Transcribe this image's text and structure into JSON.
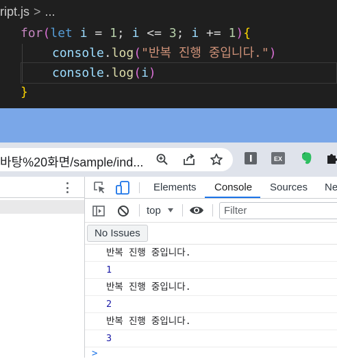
{
  "editor": {
    "breadcrumb": {
      "file": "ript.js",
      "separator": ">",
      "ellipsis": "..."
    },
    "code": {
      "line1": {
        "kw_for": "for",
        "open_paren": "(",
        "kw_let": "let",
        "var_i1": "i",
        "eq": " = ",
        "num_start": "1",
        "semi1": "; ",
        "var_i2": "i",
        "lte": " <= ",
        "num_end": "3",
        "semi2": "; ",
        "var_i3": "i",
        "inc": " += ",
        "num_step": "1",
        "close_paren": ")",
        "open_brace": "{"
      },
      "line2": {
        "obj": "console",
        "dot": ".",
        "method": "log",
        "open_paren": "(",
        "arg": "\"반복 진행 중입니다.\"",
        "close_paren": ")"
      },
      "line3": {
        "obj": "console",
        "dot": ".",
        "method": "log",
        "open_paren": "(",
        "arg": "i",
        "close_paren": ")"
      },
      "line4": {
        "close_brace": "}"
      }
    }
  },
  "browser": {
    "url": "바탕%20화면/sample/ind...",
    "icons": [
      "zoom-icon",
      "share-icon",
      "bookmark-star-icon",
      "extension-1-icon",
      "ex-extension-icon",
      "evernote-icon",
      "puzzle-icon"
    ],
    "ex_label": "EX"
  },
  "devtools": {
    "tabs": [
      {
        "label": "Elements"
      },
      {
        "label": "Console",
        "active": true
      },
      {
        "label": "Sources"
      },
      {
        "label": "Ne"
      }
    ],
    "toolbar": {
      "context": "top",
      "filter_placeholder": "Filter"
    },
    "issues_label": "No Issues",
    "messages": [
      {
        "text": "반복 진행 중입니다.",
        "type": "text"
      },
      {
        "text": "1",
        "type": "number"
      },
      {
        "text": "반복 진행 중입니다.",
        "type": "text"
      },
      {
        "text": "2",
        "type": "number"
      },
      {
        "text": "반복 진행 중입니다.",
        "type": "text"
      },
      {
        "text": "3",
        "type": "number"
      }
    ],
    "prompt": ">",
    "colors": {
      "accent": "#1a73e8",
      "number": "#1a1aa6"
    }
  }
}
